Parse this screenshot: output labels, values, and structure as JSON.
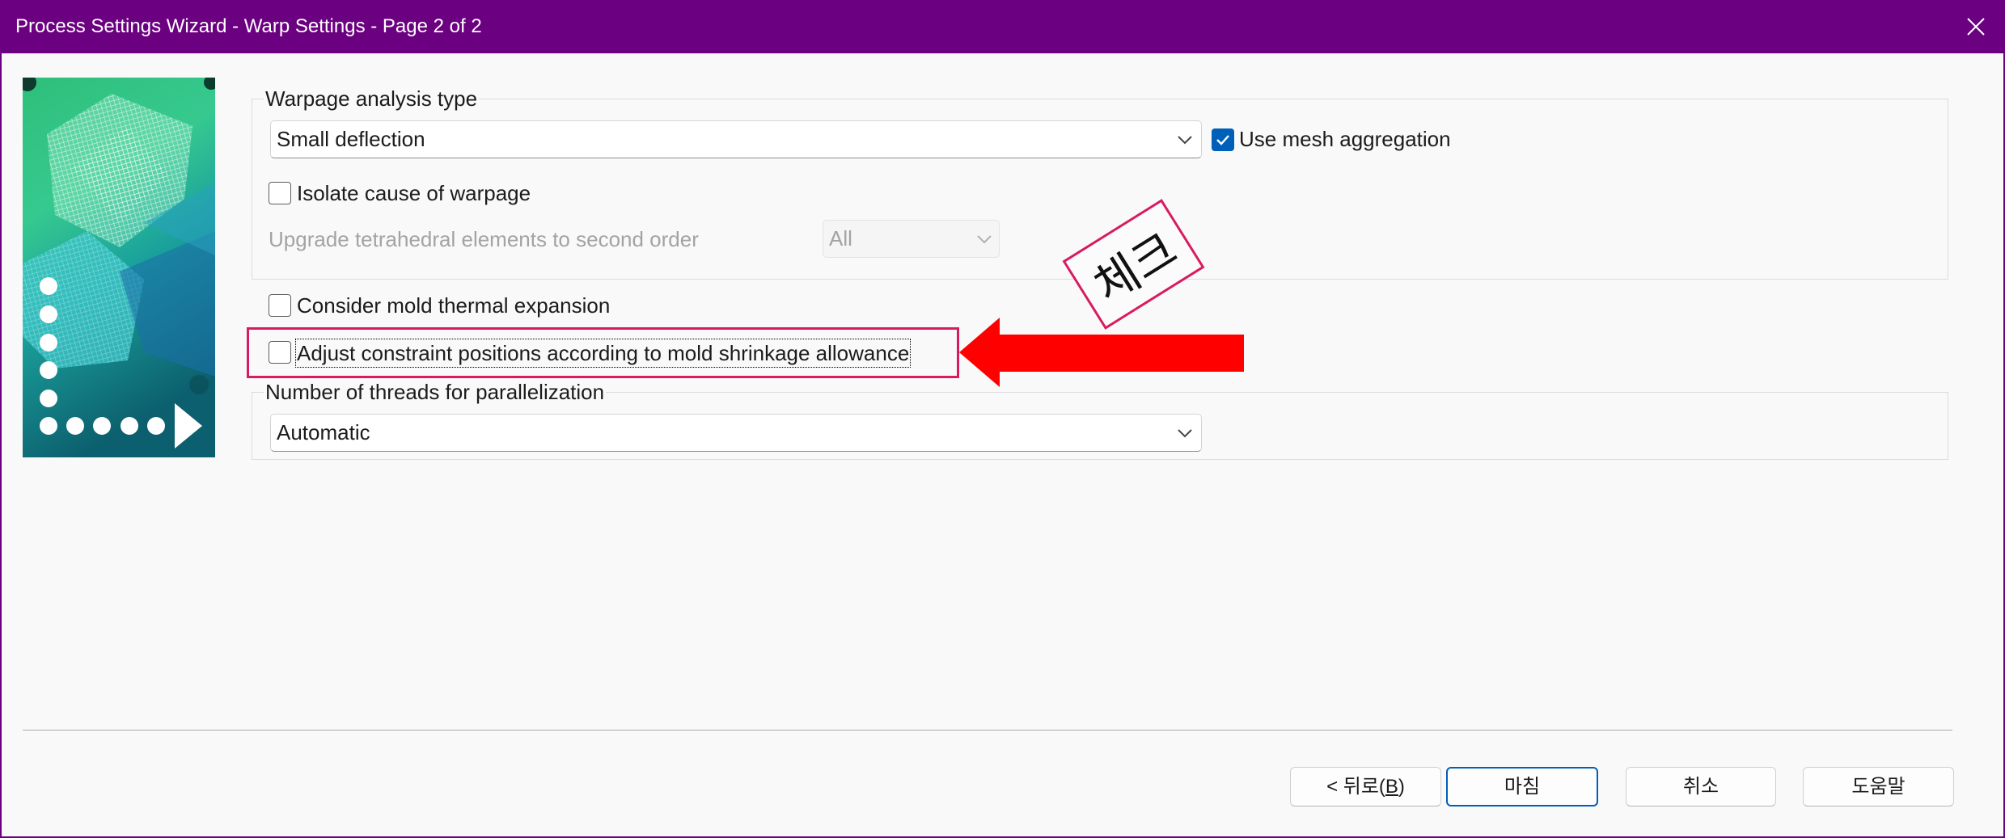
{
  "window": {
    "title": "Process Settings Wizard - Warp Settings - Page 2 of 2",
    "close_icon": "close-icon",
    "accent_color": "#6b0080"
  },
  "banner": {
    "icon": "wizard-banner-image"
  },
  "warpage_group": {
    "legend": "Warpage analysis type",
    "analysis_type": {
      "selected": "Small deflection"
    },
    "use_mesh_aggregation": {
      "label": "Use mesh aggregation",
      "checked": true
    },
    "isolate_cause": {
      "label": "Isolate cause of warpage",
      "checked": false
    },
    "upgrade_tetrahedral": {
      "label": "Upgrade tetrahedral elements to second order",
      "selected": "All",
      "enabled": false
    }
  },
  "consider_mold_thermal_expansion": {
    "label": "Consider mold thermal expansion",
    "checked": false
  },
  "adjust_constraint_positions": {
    "label": "Adjust constraint positions according to mold shrinkage allowance",
    "checked": false,
    "focused": true
  },
  "threads_group": {
    "legend": "Number of threads for parallelization",
    "selected": "Automatic"
  },
  "annotation": {
    "stamp_text": "체크",
    "highlight_color": "#d81b60",
    "arrow_color": "#ff0000",
    "arrow_icon": "left-arrow-icon"
  },
  "buttons": {
    "back": "< 뒤로(B)",
    "finish": "마침",
    "cancel": "취소",
    "help": "도움말",
    "default_color": "#005fb8"
  }
}
